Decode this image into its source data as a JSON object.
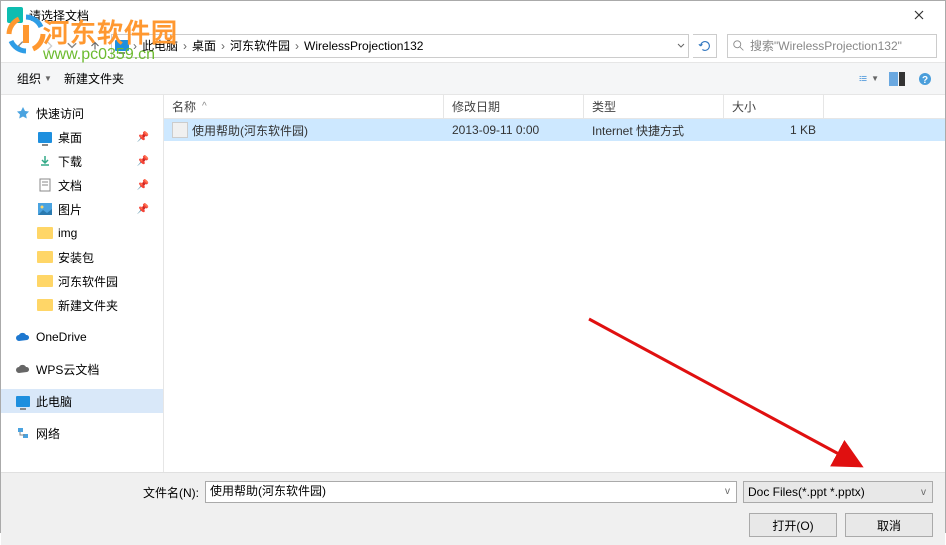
{
  "title": "请选择文档",
  "breadcrumb": {
    "items": [
      "此电脑",
      "桌面",
      "河东软件园",
      "WirelessProjection132"
    ]
  },
  "search": {
    "placeholder": "搜索\"WirelessProjection132\""
  },
  "toolbar": {
    "organize": "组织",
    "newfolder": "新建文件夹"
  },
  "sidebar": {
    "quickaccess": "快速访问",
    "desktop": "桌面",
    "downloads": "下载",
    "documents": "文档",
    "pictures": "图片",
    "img": "img",
    "installer": "安装包",
    "hedong": "河东软件园",
    "newfolder": "新建文件夹",
    "onedrive": "OneDrive",
    "wps": "WPS云文档",
    "thispc": "此电脑",
    "network": "网络"
  },
  "columns": {
    "name": "名称",
    "modified": "修改日期",
    "type": "类型",
    "size": "大小"
  },
  "files": [
    {
      "name": "使用帮助(河东软件园)",
      "modified": "2013-09-11 0:00",
      "type": "Internet 快捷方式",
      "size": "1 KB"
    }
  ],
  "filename_label": "文件名(N):",
  "filename_value": "使用帮助(河东软件园)",
  "filter": "Doc Files(*.ppt *.pptx)",
  "open_btn": "打开(O)",
  "cancel_btn": "取消",
  "watermark": {
    "line1": "河东软件园",
    "line2": "www.pc0359.cn"
  }
}
